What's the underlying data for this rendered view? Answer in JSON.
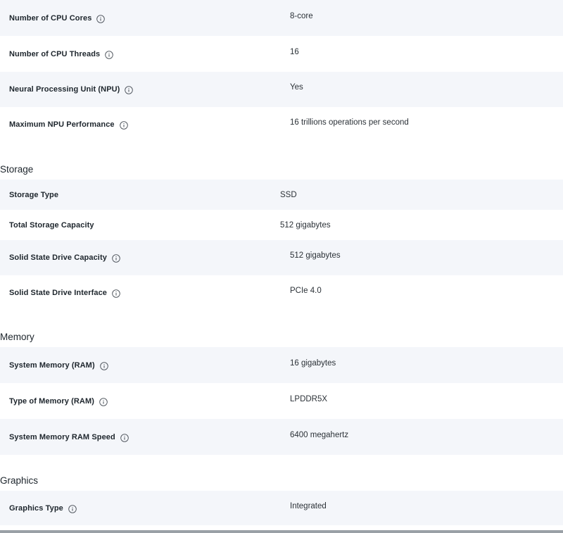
{
  "processor": {
    "rows": [
      {
        "label": "Number of CPU Cores",
        "value": "8-core",
        "info": true
      },
      {
        "label": "Number of CPU Threads",
        "value": "16",
        "info": true
      },
      {
        "label": "Neural Processing Unit (NPU)",
        "value": "Yes",
        "info": true
      },
      {
        "label": "Maximum NPU Performance",
        "value": "16 trillions operations per second",
        "info": true
      }
    ]
  },
  "storage": {
    "title": "Storage",
    "rows": [
      {
        "label": "Storage Type",
        "value": "SSD",
        "info": false
      },
      {
        "label": "Total Storage Capacity",
        "value": "512 gigabytes",
        "info": false
      },
      {
        "label": "Solid State Drive Capacity",
        "value": "512 gigabytes",
        "info": true
      },
      {
        "label": "Solid State Drive Interface",
        "value": "PCIe 4.0",
        "info": true
      }
    ]
  },
  "memory": {
    "title": "Memory",
    "rows": [
      {
        "label": "System Memory (RAM)",
        "value": "16 gigabytes",
        "info": true
      },
      {
        "label": "Type of Memory (RAM)",
        "value": "LPDDR5X",
        "info": true
      },
      {
        "label": "System Memory RAM Speed",
        "value": "6400 megahertz",
        "info": true
      }
    ]
  },
  "graphics": {
    "title": "Graphics",
    "rows": [
      {
        "label": "Graphics Type",
        "value": "Integrated",
        "info": true
      }
    ]
  },
  "icons": {
    "info": "info-circle-icon"
  },
  "colors": {
    "row_alt_bg": "#f4f6fa",
    "text": "#1d252c",
    "icon": "#4a5058"
  }
}
